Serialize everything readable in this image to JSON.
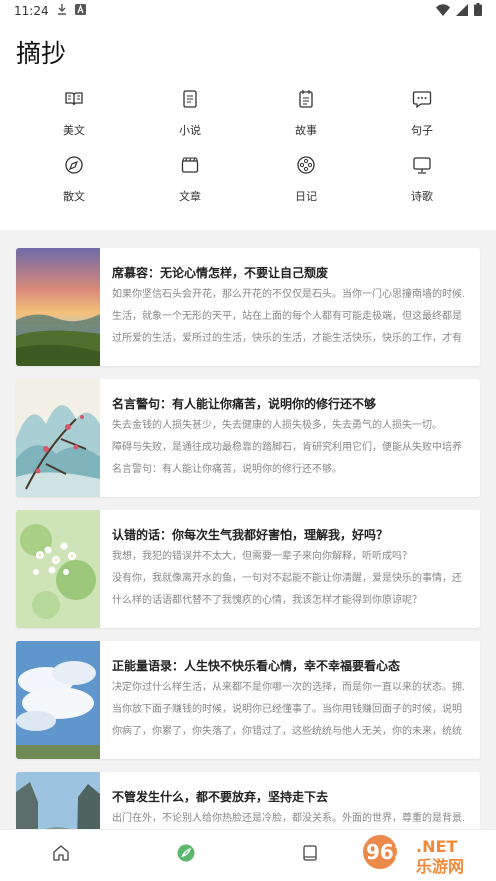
{
  "status_bar": {
    "time": "11:24"
  },
  "header": {
    "title": "摘抄"
  },
  "categories": [
    {
      "label": "美文",
      "icon": "book-open-icon"
    },
    {
      "label": "小说",
      "icon": "document-icon"
    },
    {
      "label": "故事",
      "icon": "notebook-icon"
    },
    {
      "label": "句子",
      "icon": "chat-bubble-icon"
    },
    {
      "label": "散文",
      "icon": "compass-icon"
    },
    {
      "label": "文章",
      "icon": "clapperboard-icon"
    },
    {
      "label": "日记",
      "icon": "film-reel-icon"
    },
    {
      "label": "诗歌",
      "icon": "monitor-icon"
    }
  ],
  "articles": [
    {
      "title": "席慕容：无论心情怎样，不要让自己颓废",
      "lines": [
        "如果你坚信石头会开花，那么开花的不仅仅是石头。当你一门心思撞南墙的时候...",
        "生活，就象一个无形的天平，站在上面的每个人都有可能走极端，但这最终都是",
        "过所爱的生活，爱所过的生活，快乐的生活，才能生活快乐，快乐的工作，才有"
      ],
      "image": "sunset-landscape"
    },
    {
      "title": "名言警句：有人能让你痛苦，说明你的修行还不够",
      "lines": [
        "失去金钱的人损失甚少，失去健康的人损失极多，失去勇气的人损失一切。",
        "障碍与失败，是通往成功最稳靠的踏脚石，肯研究利用它们，便能从失败中培养",
        "名言警句：有人能让你痛苦，说明你的修行还不够。"
      ],
      "image": "plum-blossom-painting"
    },
    {
      "title": "认错的话：你每次生气我都好害怕，理解我，好吗？",
      "lines": [
        "我想，我犯的错误并不太大，但需要一辈子来向你解释，听听成吗？",
        "没有你，我就像离开水的鱼，一句对不起能不能让你清醒，爱是快乐的事情，还",
        "什么样的话语都代替不了我愧疚的心情，我该怎样才能得到你原谅呢？"
      ],
      "image": "white-flowers"
    },
    {
      "title": "正能量语录：人生快不快乐看心情，幸不幸福要看心态",
      "lines": [
        "决定你过什么样生活，从来都不是你哪一次的选择，而是你一直以来的状态。拥...",
        "当你放下面子赚钱的时候，说明你已经懂事了。当你用钱赚回面子的时候，说明",
        "你病了，你累了，你失落了，你错过了，这些统统与他人无关，你的未来，统统"
      ],
      "image": "blue-sky-clouds"
    },
    {
      "title": "不管发生什么，都不要放弃，坚持走下去",
      "lines": [
        "出门在外，不论别人给你热脸还是冷脸，都没关系。外面的世界，尊重的是背景..."
      ],
      "image": "mountain-cliffs"
    }
  ],
  "tabbar": {
    "items": [
      {
        "name": "home-icon"
      },
      {
        "name": "feather-icon"
      },
      {
        "name": "book-icon"
      }
    ]
  },
  "watermark": {
    "text_logo": "962",
    "text_net": ".NET",
    "text_cn": "乐游网"
  }
}
